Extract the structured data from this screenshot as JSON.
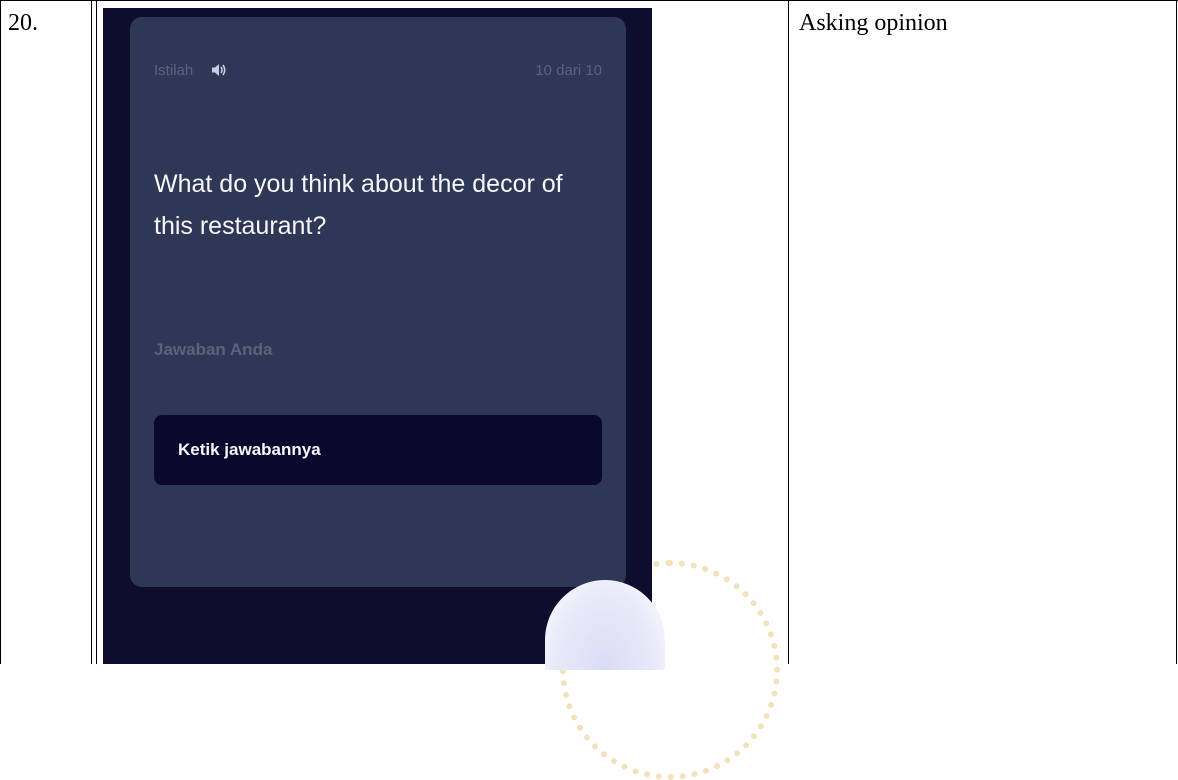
{
  "row": {
    "number": "20.",
    "remark": "Asking opinion"
  },
  "flashcard": {
    "term_label": "Istilah",
    "progress": "10 dari 10",
    "question": "What do you think about the decor of this restaurant?",
    "answer_label": "Jawaban Anda",
    "answer_placeholder": "Ketik jawabannya",
    "answer_value": ""
  },
  "icons": {
    "speaker": "speaker-icon"
  },
  "colors": {
    "app_background": "#0e0d2e",
    "card_background": "#2e3856",
    "input_background": "#0a092d",
    "muted_text": "#586380",
    "primary_text": "#f6f7fb"
  }
}
